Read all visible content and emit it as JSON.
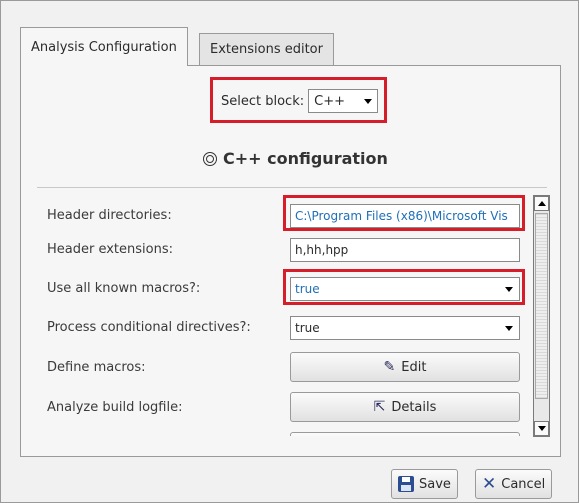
{
  "tabs": [
    {
      "label": "Analysis Configuration",
      "active": true
    },
    {
      "label": "Extensions editor",
      "active": false
    }
  ],
  "select_block": {
    "label": "Select block:",
    "value": "C++"
  },
  "section_title": "C++ configuration",
  "fields": {
    "header_directories": {
      "label": "Header directories:",
      "value": "C:\\Program Files (x86)\\Microsoft Vis"
    },
    "header_extensions": {
      "label": "Header extensions:",
      "value": "h,hh,hpp"
    },
    "use_all_known_macros": {
      "label": "Use all known macros?:",
      "value": "true"
    },
    "process_conditional_directives": {
      "label": "Process conditional directives?:",
      "value": "true"
    },
    "define_macros": {
      "label": "Define macros:",
      "button": "Edit"
    },
    "analyze_build_logfile": {
      "label": "Analyze build logfile:",
      "button": "Details"
    }
  },
  "footer": {
    "save_label": "Save",
    "cancel_label": "Cancel"
  },
  "colors": {
    "highlight": "#d61e2b",
    "link": "#1f6fb8",
    "icon_blue": "#2c4d8f"
  },
  "icons": {
    "section": "radio-target-icon",
    "edit": "pencil-icon",
    "details": "external-link-icon",
    "save": "floppy-disk-icon",
    "cancel": "x-icon"
  }
}
